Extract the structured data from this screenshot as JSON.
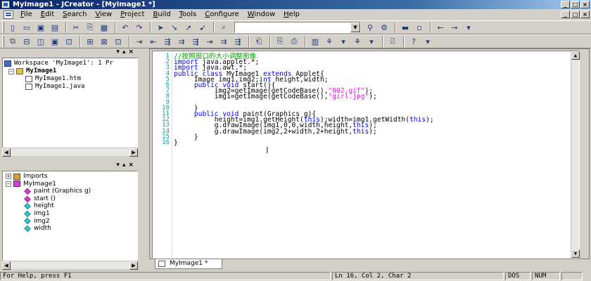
{
  "window": {
    "title": "MyImage1 - JCreator - [MyImage1 *]"
  },
  "menu": [
    {
      "label": "File",
      "u": "F"
    },
    {
      "label": "Edit",
      "u": "E"
    },
    {
      "label": "Search",
      "u": "S"
    },
    {
      "label": "View",
      "u": "V"
    },
    {
      "label": "Project",
      "u": "P"
    },
    {
      "label": "Build",
      "u": "B"
    },
    {
      "label": "Tools",
      "u": "T"
    },
    {
      "label": "Configure",
      "u": "C"
    },
    {
      "label": "Window",
      "u": "W"
    },
    {
      "label": "Help",
      "u": "H"
    }
  ],
  "toolbar": {
    "find_combo_value": ""
  },
  "workspace": {
    "root": "Workspace 'MyImage1': 1 Pr",
    "project": "MyImage1",
    "files": [
      "MyImage1.htm",
      "MyImage1.java"
    ]
  },
  "classview": {
    "imports": "Imports",
    "class": "MyImage1",
    "members": [
      {
        "label": "paint (Graphics g)",
        "kind": "method"
      },
      {
        "label": "start ()",
        "kind": "method"
      },
      {
        "label": "height",
        "kind": "field"
      },
      {
        "label": "img1",
        "kind": "field"
      },
      {
        "label": "img2",
        "kind": "field"
      },
      {
        "label": "width",
        "kind": "field"
      }
    ]
  },
  "editor": {
    "lines": [
      {
        "n": "1",
        "html": "<span class=\"cm\">//按照窗口的大小调整图像</span>"
      },
      {
        "n": "2",
        "html": "<span class=\"kw\">import</span> java.applet.*;"
      },
      {
        "n": "3",
        "html": "<span class=\"kw\">import</span> java.awt.*;"
      },
      {
        "n": "4",
        "html": "<span class=\"kw\">public class</span> MyImage1 <span class=\"kw\">extends</span> Applet{"
      },
      {
        "n": "5",
        "html": "     Image img1,img2;<span class=\"kw\">int</span> height,width;"
      },
      {
        "n": "6",
        "html": "     <span class=\"kw\">public void</span> start(){"
      },
      {
        "n": "7",
        "html": "          img2=getImage(getCodeBase(),<span class=\"st\">\"002.gif\"</span>);"
      },
      {
        "n": "8",
        "html": "          img1=getImage(getCodeBase(),<span class=\"st\">\"girl.jpg\"</span>);"
      },
      {
        "n": "9",
        "html": ""
      },
      {
        "n": "10",
        "html": "     }"
      },
      {
        "n": "11",
        "html": "     <span class=\"kw\">public void</span> paint(Graphics g){"
      },
      {
        "n": "12",
        "html": "          height=img1.getHeight(<span class=\"kw\">this</span>);width=img1.getWidth(<span class=\"kw\">this</span>);"
      },
      {
        "n": "13",
        "html": "          g.drawImage(img1,0,0,width,height,<span class=\"kw\">this</span>);"
      },
      {
        "n": "14",
        "html": "          g.drawImage(img2,2+width,2+height,<span class=\"kw\">this</span>);"
      },
      {
        "n": "15",
        "html": "     }"
      },
      {
        "n": "16",
        "html": "}"
      }
    ]
  },
  "tab": {
    "label": "MyImage1 *"
  },
  "status": {
    "help": "For Help, press F1",
    "position": "Ln 16, Col 2, Char 2",
    "format": "DOS",
    "num": "NUM"
  }
}
